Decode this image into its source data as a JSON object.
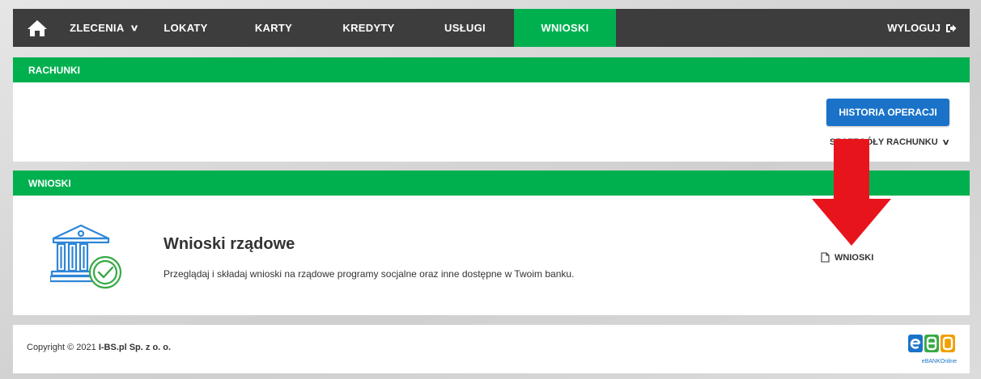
{
  "nav": {
    "items": [
      {
        "label": "ZLECENIA",
        "dropdown": true
      },
      {
        "label": "LOKATY"
      },
      {
        "label": "KARTY"
      },
      {
        "label": "KREDYTY"
      },
      {
        "label": "USŁUGI"
      },
      {
        "label": "WNIOSKI",
        "active": true
      }
    ],
    "logout_label": "WYLOGUJ"
  },
  "rachunki": {
    "header": "RACHUNKI",
    "history_button": "HISTORIA OPERACJI",
    "details_label": "SZCZEGÓŁY RACHUNKU"
  },
  "wnioski": {
    "header": "WNIOSKI",
    "title": "Wnioski rządowe",
    "description": "Przeglądaj i składaj wnioski na rządowe programy socjalne oraz inne dostępne w Twoim banku.",
    "link_label": "WNIOSKI"
  },
  "footer": {
    "copyright_prefix": "Copyright © 2021 ",
    "company": "I-BS.pl Sp. z o. o.",
    "logo_text": "eBANKOnline"
  },
  "colors": {
    "nav_bg": "#3d3d3d",
    "accent_green": "#00b04f",
    "button_blue": "#1a73c8",
    "annotation_arrow": "#e8141c"
  }
}
